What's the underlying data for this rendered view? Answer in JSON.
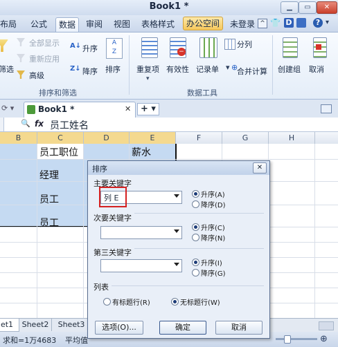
{
  "window": {
    "title": "Book1 *"
  },
  "menu": {
    "tabs": [
      "布局",
      "公式",
      "数据",
      "审阅",
      "视图",
      "表格样式",
      "办公空间"
    ],
    "active": "数据",
    "login": "未登录"
  },
  "ribbon": {
    "sort_filter": {
      "show_all": "全部显示",
      "reapply": "重新应用",
      "filter_partial": "筛选",
      "advanced": "高级",
      "asc": "升序",
      "desc": "降序",
      "sort": "排序",
      "group_label": "排序和筛选"
    },
    "data_tools": {
      "duplicates": "重复项",
      "validity": "有效性",
      "record_sheet": "记录单",
      "split_column": "分列",
      "consolidate": "合并计算",
      "group_label": "数据工具"
    },
    "outline": {
      "create_group": "创建组",
      "ungroup_partial": "取消"
    }
  },
  "doc_tab": {
    "title": "Book1 *"
  },
  "formula_bar": {
    "content": "员工姓名"
  },
  "columns": [
    "B",
    "C",
    "D",
    "E",
    "F",
    "G",
    "H"
  ],
  "cells": {
    "c1": "员工职位",
    "e1": "薪水",
    "c2": "经理",
    "c3": "员工",
    "c4": "员工"
  },
  "sheet_tabs": [
    "et1",
    "Sheet2",
    "Sheet3"
  ],
  "status": {
    "sum": "求和=1万4683",
    "avg_partial": "平均值"
  },
  "sort_dialog": {
    "title": "排序",
    "primary_key_label": "主要关键字",
    "primary_key_value": "列 E",
    "secondary_key_label": "次要关键字",
    "tertiary_key_label": "第三关键字",
    "ascending_a": "升序(A)",
    "descending_d": "降序(D)",
    "ascending_c": "升序(C)",
    "descending_n": "降序(N)",
    "ascending_i": "升序(I)",
    "descending_g": "降序(G)",
    "list_label": "列表",
    "has_header": "有标题行(R)",
    "no_header": "无标题行(W)",
    "options_button": "选项(O)...",
    "ok_button": "确定",
    "cancel_button": "取消"
  },
  "colors": {
    "accent": "#1d3c78",
    "selection": "#c5daf2",
    "highlight_box": "#d42020"
  }
}
